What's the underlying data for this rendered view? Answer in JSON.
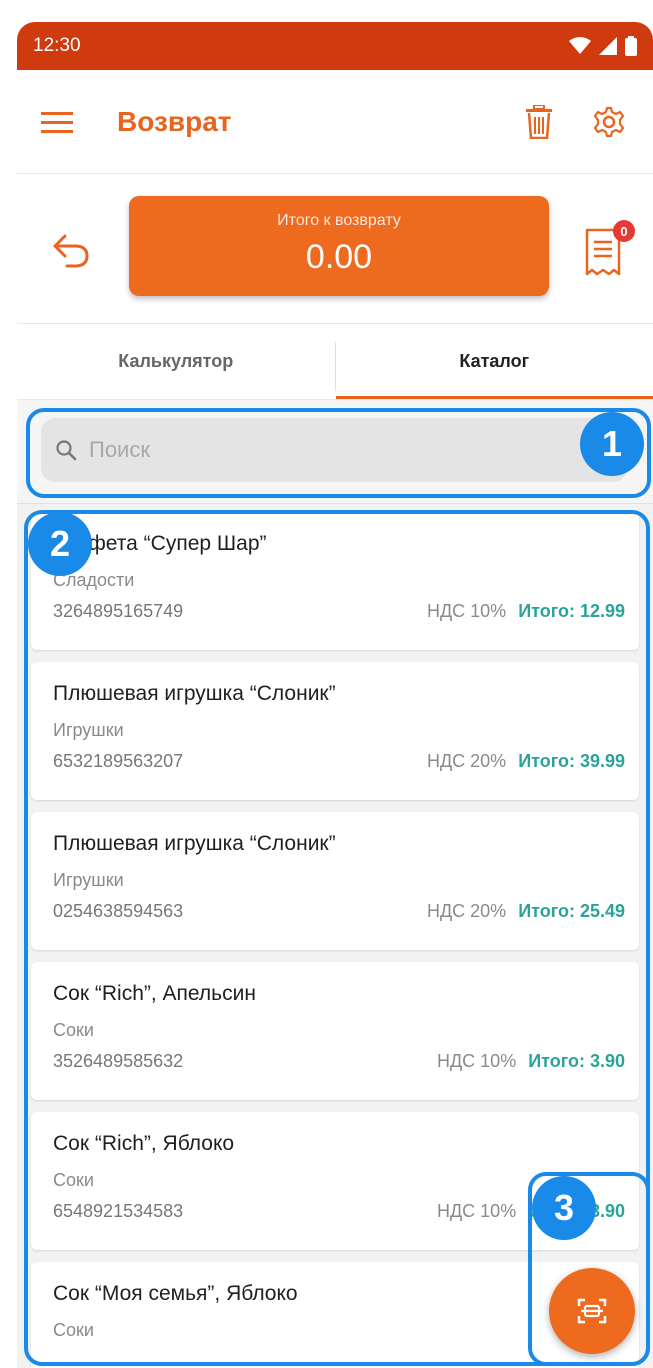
{
  "status_bar": {
    "time": "12:30"
  },
  "app_bar": {
    "title": "Возврат",
    "icons": [
      "menu-icon",
      "trash-icon",
      "settings-icon"
    ]
  },
  "return_total": {
    "label": "Итого к возврату",
    "value": "0.00",
    "receipt_badge": "0"
  },
  "tabs": [
    {
      "label": "Калькулятор",
      "active": false
    },
    {
      "label": "Каталог",
      "active": true
    }
  ],
  "search": {
    "placeholder": "Поиск"
  },
  "items": [
    {
      "name": "Конфета “Супер Шар”",
      "category": "Сладости",
      "code": "3264895165749",
      "vat": "НДС 10%",
      "total": "Итого: 12.99"
    },
    {
      "name": "Плюшевая игрушка “Слоник”",
      "category": "Игрушки",
      "code": "6532189563207",
      "vat": "НДС 20%",
      "total": "Итого: 39.99"
    },
    {
      "name": "Плюшевая игрушка “Слоник”",
      "category": "Игрушки",
      "code": "0254638594563",
      "vat": "НДС 20%",
      "total": "Итого: 25.49"
    },
    {
      "name": "Сок “Rich”, Апельсин",
      "category": "Соки",
      "code": "3526489585632",
      "vat": "НДС 10%",
      "total": "Итого: 3.90"
    },
    {
      "name": "Сок “Rich”, Яблоко",
      "category": "Соки",
      "code": "6548921534583",
      "vat": "НДС 10%",
      "total": "Итого: 3.90"
    },
    {
      "name": "Сок “Моя семья”, Яблоко",
      "category": "Соки",
      "code": "",
      "vat": "",
      "total": ""
    }
  ],
  "annotations": [
    "1",
    "2",
    "3"
  ],
  "colors": {
    "status_bar": "#d03a0f",
    "accent": "#e8641f",
    "total_green": "#2aa39a",
    "annotation_blue": "#1a8ae8"
  }
}
